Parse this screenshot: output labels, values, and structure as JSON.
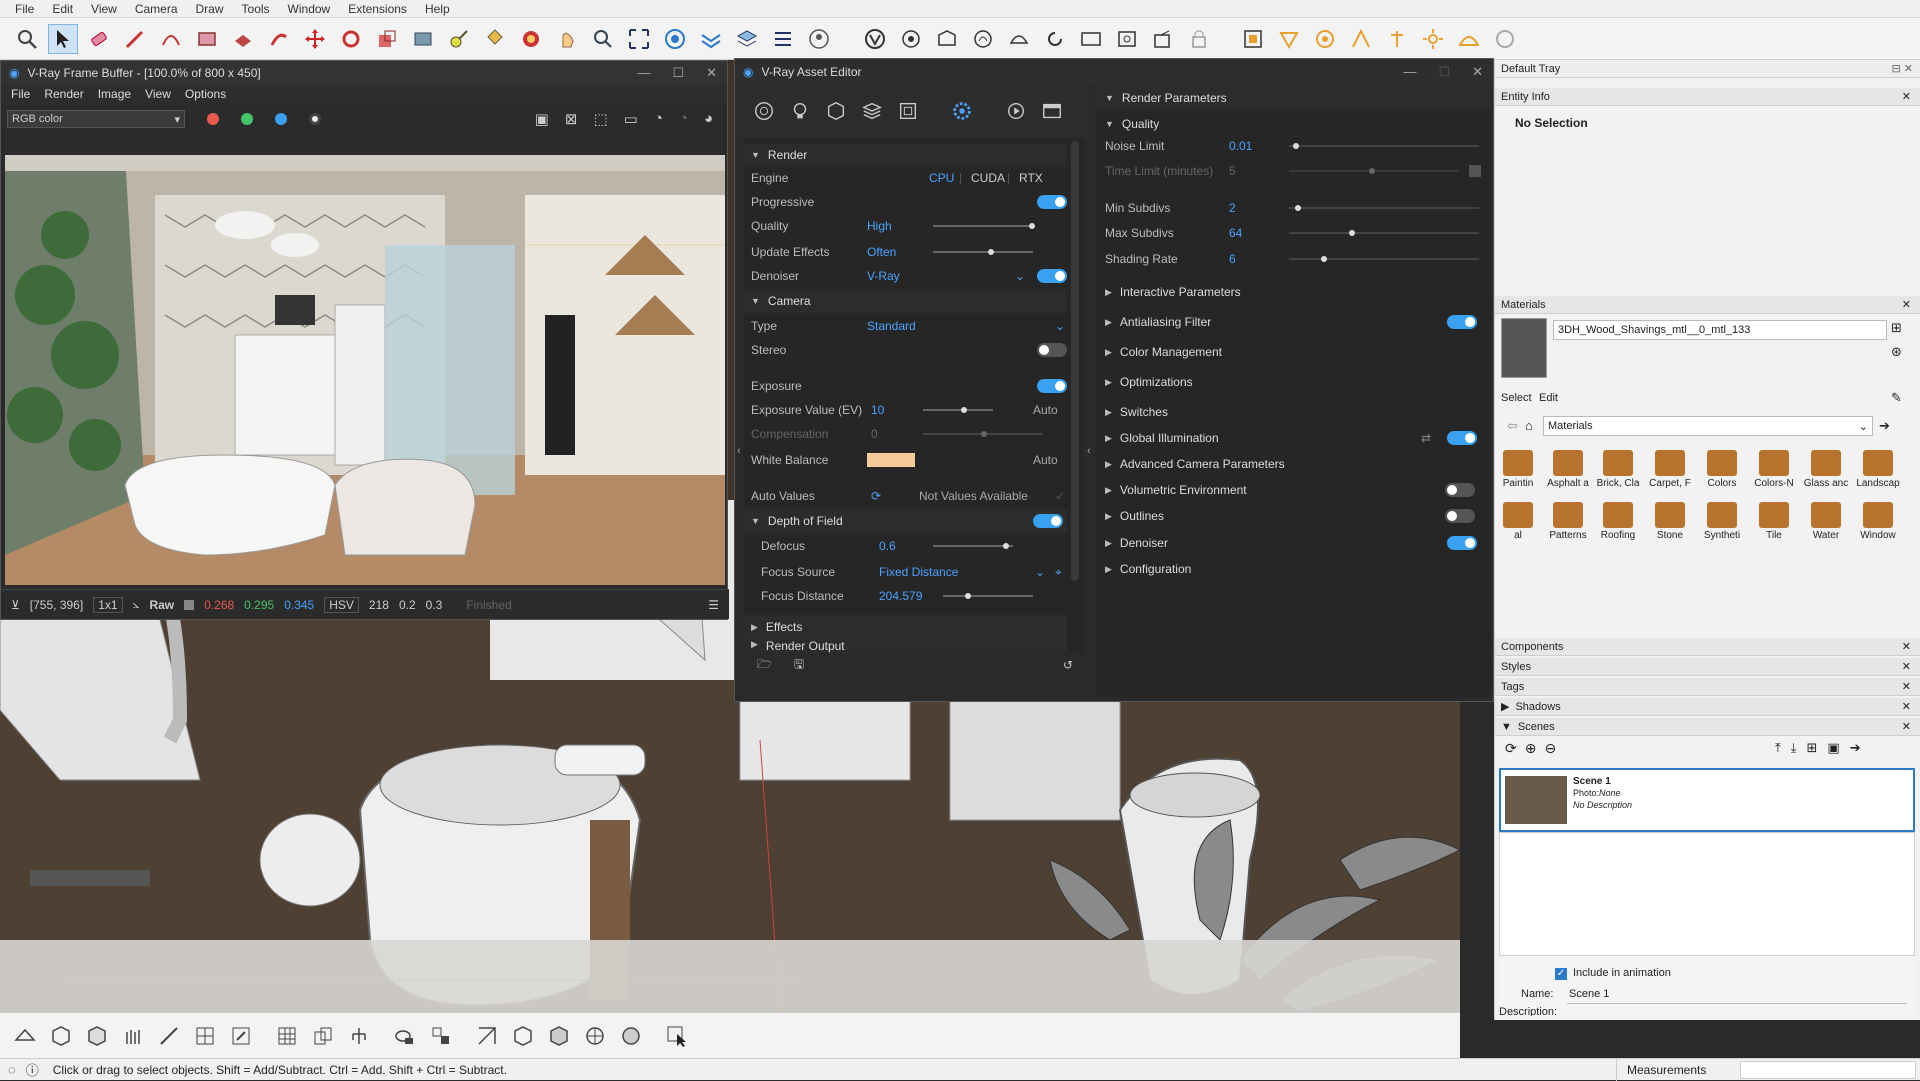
{
  "menubar": {
    "items": [
      "File",
      "Edit",
      "View",
      "Camera",
      "Draw",
      "Tools",
      "Window",
      "Extensions",
      "Help"
    ]
  },
  "statusbar": {
    "hint": "Click or drag to select objects. Shift = Add/Subtract. Ctrl = Add. Shift + Ctrl = Subtract.",
    "measurements": "Measurements"
  },
  "vfb": {
    "title": "V-Ray Frame Buffer - [100.0% of 800 x 450]",
    "menu": [
      "File",
      "Render",
      "Image",
      "View",
      "Options"
    ],
    "channel": "RGB color",
    "colors": {
      "red": "#e85a4f",
      "green": "#46c46a",
      "blue": "#3aa0f0"
    },
    "status": {
      "coords": "[755, 396]",
      "zoom": "1x1",
      "mode": "Raw",
      "r": "0.268",
      "g": "0.295",
      "b": "0.345",
      "space": "HSV",
      "h": "218",
      "s": "0.2",
      "v": "0.3",
      "state": "Finished"
    }
  },
  "vae": {
    "title": "V-Ray Asset Editor",
    "render": {
      "header": "Render",
      "engine_label": "Engine",
      "engines": [
        "CPU",
        "CUDA",
        "RTX"
      ],
      "progressive_label": "Progressive",
      "quality_label": "Quality",
      "quality": "High",
      "update_label": "Update Effects",
      "update": "Often",
      "denoiser_label": "Denoiser",
      "denoiser": "V-Ray"
    },
    "camera": {
      "header": "Camera",
      "type_label": "Type",
      "type": "Standard",
      "stereo_label": "Stereo",
      "exposure_label": "Exposure",
      "ev_label": "Exposure Value (EV)",
      "ev": "10",
      "ev_auto": "Auto",
      "comp_label": "Compensation",
      "comp": "0",
      "wb_label": "White Balance",
      "wb_auto": "Auto",
      "wb_color": "#f6c99a",
      "auto_label": "Auto Values",
      "auto_val": "Not Values Available"
    },
    "dof": {
      "header": "Depth of Field",
      "defocus_label": "Defocus",
      "defocus": "0.6",
      "source_label": "Focus Source",
      "source": "Fixed Distance",
      "distance_label": "Focus Distance",
      "distance": "204.579"
    },
    "effects": "Effects",
    "render_output": "Render Output",
    "params": {
      "header": "Render Parameters",
      "quality": "Quality",
      "noise_label": "Noise Limit",
      "noise": "0.01",
      "time_label": "Time Limit (minutes)",
      "time": "5",
      "minsub_label": "Min Subdivs",
      "minsub": "2",
      "maxsub_label": "Max Subdivs",
      "maxsub": "64",
      "shading_label": "Shading Rate",
      "shading": "6",
      "sections": [
        "Interactive Parameters",
        "Antialiasing Filter",
        "Color Management",
        "Optimizations",
        "Switches",
        "Global Illumination",
        "Advanced Camera Parameters",
        "Volumetric Environment",
        "Outlines",
        "Denoiser",
        "Configuration"
      ]
    }
  },
  "tray": {
    "title": "Default Tray",
    "entity": "Entity Info",
    "selection": "No Selection",
    "materials": "Materials",
    "mat_name": "3DH_Wood_Shavings_mtl__0_mtl_133",
    "tabs": [
      "Select",
      "Edit"
    ],
    "library": "Materials",
    "mats": [
      "Asphalt a",
      "Brick, Cla",
      "Carpet, F",
      "Colors",
      "Colors-N",
      "Glass anc",
      "Landscap",
      "Patterns",
      "Roofing",
      "Stone",
      "Syntheti",
      "Tile",
      "Water",
      "Window"
    ],
    "panels": [
      "Components",
      "Styles",
      "Tags",
      "Shadows",
      "Scenes"
    ],
    "scene_name": "Scene 1",
    "scene_photo_label": "Photo:",
    "scene_photo": "None",
    "scene_desc": "No Description",
    "include": "Include in animation",
    "name_label": "Name:",
    "name_value": "Scene 1",
    "desc_label": "Description:"
  }
}
